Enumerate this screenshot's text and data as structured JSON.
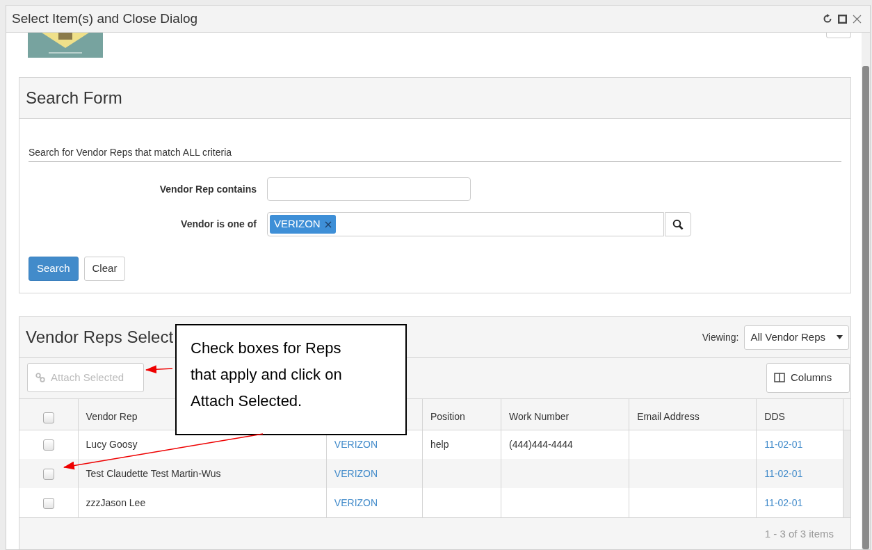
{
  "window": {
    "title": "Select Item(s) and Close Dialog"
  },
  "search_form": {
    "title": "Search Form",
    "subtitle": "Search for Vendor Reps that match ALL criteria",
    "fields": [
      {
        "kind": "text",
        "label": "Vendor Rep contains"
      },
      {
        "kind": "tags",
        "label": "Vendor is one of",
        "tags": [
          "VERIZON"
        ]
      }
    ],
    "buttons": [
      {
        "label": "Search",
        "kind": "primary"
      },
      {
        "label": "Clear",
        "kind": "default"
      }
    ]
  },
  "grid": {
    "title": "Vendor Reps Select",
    "viewing_label": "Viewing:",
    "viewing_value": "All Vendor Reps",
    "attach_button": {
      "label": "Attach Selected",
      "disabled": true
    },
    "columns_button": "Columns",
    "select_all": {
      "checked": false
    },
    "columns": [
      {
        "kind": "text",
        "label": "Vendor Rep"
      },
      {
        "kind": "link"
      },
      {
        "kind": "text",
        "label": "Position"
      },
      {
        "kind": "text",
        "label": "Work Number"
      },
      {
        "label": "Email Address"
      },
      {
        "kind": "link",
        "label": "DDS"
      }
    ],
    "rows": [
      {
        "checked": false,
        "cells": [
          "Lucy Goosy",
          "VERIZON",
          "help",
          "(444)444-4444",
          null,
          "11-02-01"
        ]
      },
      {
        "checked": false,
        "cells": [
          "Test Claudette Test Martin-Wus",
          "VERIZON",
          null,
          null,
          null,
          "11-02-01"
        ]
      },
      {
        "checked": false,
        "cells": [
          "zzzJason Lee",
          "VERIZON",
          null,
          null,
          null,
          "11-02-01"
        ]
      }
    ],
    "pager": "1 - 3 of 3 items"
  },
  "callout": {
    "text": "Check boxes for Reps that apply and click on Attach Selected."
  }
}
